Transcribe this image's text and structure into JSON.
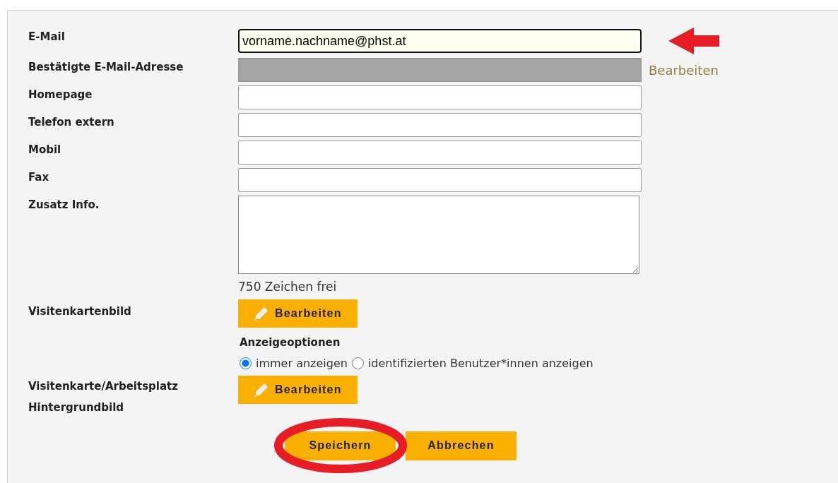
{
  "fields": [
    {
      "label": "E-Mail",
      "kind": "input",
      "value": "vorname.nachname@phst.at",
      "focused": true,
      "marked": true
    },
    {
      "label": "Bestätigte E-Mail-Adresse",
      "kind": "input",
      "disabled": true,
      "link": "Bearbeiten"
    },
    {
      "label": "Homepage",
      "kind": "input"
    },
    {
      "label": "Telefon extern",
      "kind": "input"
    },
    {
      "label": "Mobil",
      "kind": "input"
    },
    {
      "label": "Fax",
      "kind": "input"
    },
    {
      "label": "Zusatz Info.",
      "kind": "textarea",
      "counter": "750 Zeichen frei"
    }
  ],
  "card_image": {
    "label": "Visitenkartenbild",
    "button": "Bearbeiten",
    "options_title": "Anzeigeoptionen",
    "options": [
      {
        "label": "immer anzeigen",
        "selected": true
      },
      {
        "label": "identifizierten Benutzer*innen anzeigen",
        "selected": false
      }
    ]
  },
  "background_image": {
    "label": "Visitenkarte/Arbeitsplatz Hintergrundbild",
    "button": "Bearbeiten"
  },
  "actions": [
    {
      "label": "Speichern",
      "highlighted": true
    },
    {
      "label": "Abbrechen",
      "highlighted": false
    }
  ]
}
